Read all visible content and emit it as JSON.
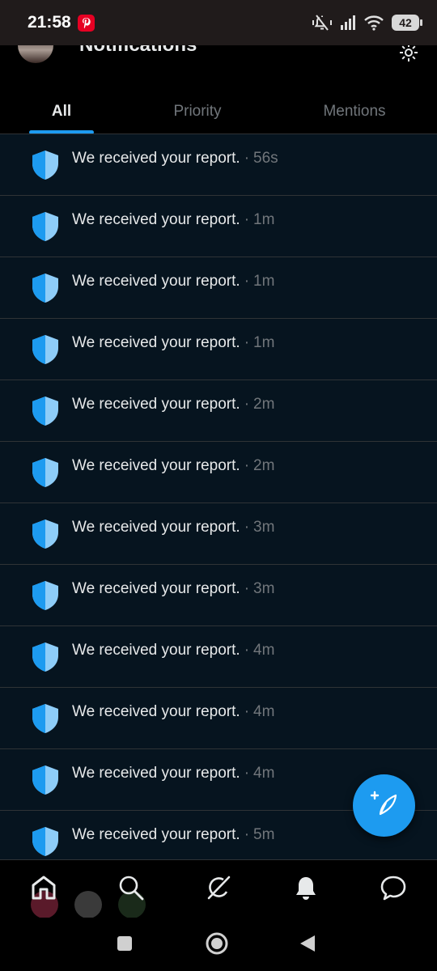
{
  "status_bar": {
    "time": "21:58",
    "battery": "42",
    "icons": [
      "pinterest-icon",
      "mute-vibrate-icon",
      "signal-icon",
      "wifi-icon",
      "battery-icon"
    ]
  },
  "header": {
    "title": "Notifications",
    "tabs": [
      {
        "label": "All",
        "active": true
      },
      {
        "label": "Priority",
        "active": false
      },
      {
        "label": "Mentions",
        "active": false
      }
    ]
  },
  "notifications": [
    {
      "icon": "shield-icon",
      "message": "We received your report.",
      "separator": "·",
      "time": "56s"
    },
    {
      "icon": "shield-icon",
      "message": "We received your report.",
      "separator": "·",
      "time": "1m"
    },
    {
      "icon": "shield-icon",
      "message": "We received your report.",
      "separator": "·",
      "time": "1m"
    },
    {
      "icon": "shield-icon",
      "message": "We received your report.",
      "separator": "·",
      "time": "1m"
    },
    {
      "icon": "shield-icon",
      "message": "We received your report.",
      "separator": "·",
      "time": "2m"
    },
    {
      "icon": "shield-icon",
      "message": "We received your report.",
      "separator": "·",
      "time": "2m"
    },
    {
      "icon": "shield-icon",
      "message": "We received your report.",
      "separator": "·",
      "time": "3m"
    },
    {
      "icon": "shield-icon",
      "message": "We received your report.",
      "separator": "·",
      "time": "3m"
    },
    {
      "icon": "shield-icon",
      "message": "We received your report.",
      "separator": "·",
      "time": "4m"
    },
    {
      "icon": "shield-icon",
      "message": "We received your report.",
      "separator": "·",
      "time": "4m"
    },
    {
      "icon": "shield-icon",
      "message": "We received your report.",
      "separator": "·",
      "time": "4m"
    },
    {
      "icon": "shield-icon",
      "message": "We received your report.",
      "separator": "·",
      "time": "5m"
    }
  ],
  "fab": {
    "icon": "compose-post-icon"
  },
  "bottom_nav": [
    "home-icon",
    "search-icon",
    "grok-icon",
    "notifications-bell-icon",
    "messages-icon"
  ],
  "system_nav": [
    "recents-square-icon",
    "home-circle-icon",
    "back-triangle-icon"
  ],
  "colors": {
    "accent": "#1d9bf0",
    "shield_light": "#8ecdf8",
    "background": "#000000",
    "row_background": "#06141f",
    "divider": "#2f3336",
    "secondary_text": "#71767b"
  }
}
